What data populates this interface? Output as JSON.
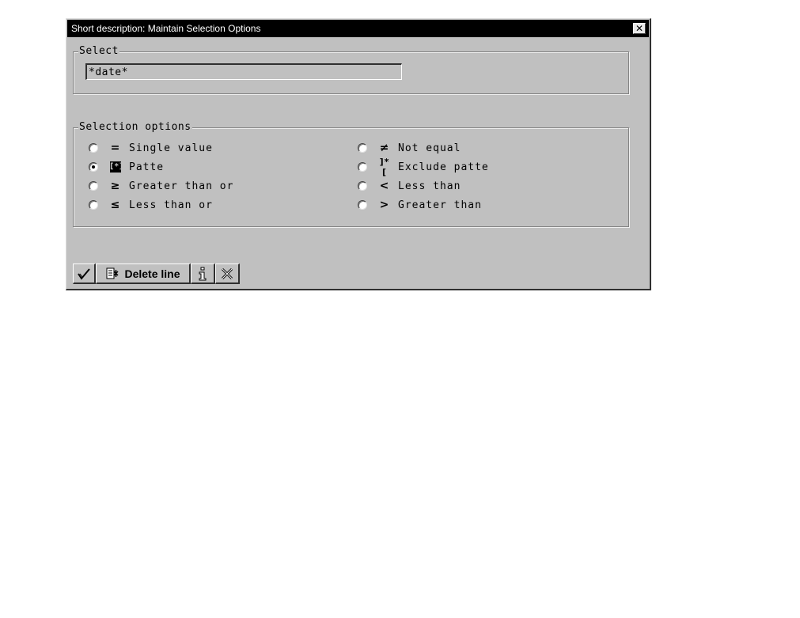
{
  "dialog": {
    "title": "Short description: Maintain Selection Options",
    "close_glyph": "✕"
  },
  "select_group": {
    "title": "Select",
    "value": "*date*"
  },
  "options_group": {
    "title": "Selection options",
    "left": [
      {
        "symbol": "=",
        "label": "Single value",
        "checked": false
      },
      {
        "symbol": "[*]",
        "label": "Patte",
        "checked": true
      },
      {
        "symbol": "≥",
        "label": "Greater than or",
        "checked": false
      },
      {
        "symbol": "≤",
        "label": "Less than or",
        "checked": false
      }
    ],
    "right": [
      {
        "symbol": "≠",
        "label": "Not equal",
        "checked": false
      },
      {
        "symbol": "]*[",
        "label": "Exclude patte",
        "checked": false
      },
      {
        "symbol": "<",
        "label": "Less than",
        "checked": false
      },
      {
        "symbol": ">",
        "label": "Greater than",
        "checked": false
      }
    ]
  },
  "toolbar": {
    "execute_icon": "checkmark-icon",
    "delete_icon": "delete-line-icon",
    "delete_label": "Delete line",
    "info_icon": "info-icon",
    "cancel_icon": "cancel-x-icon"
  }
}
